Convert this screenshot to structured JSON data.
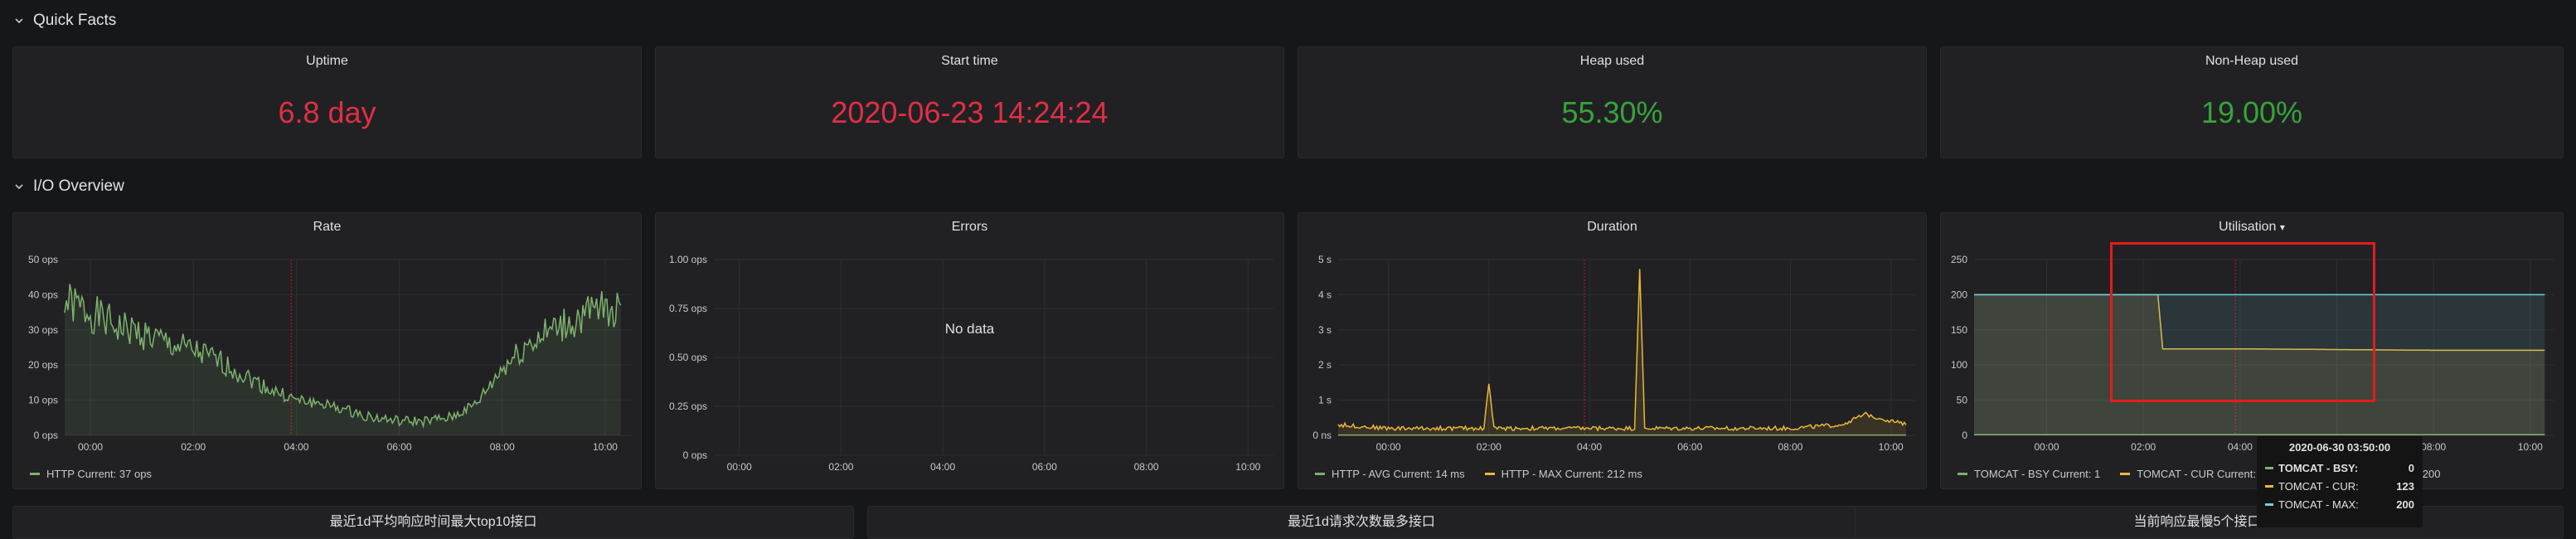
{
  "rows": {
    "quick_facts": "Quick Facts",
    "io_overview": "I/O Overview"
  },
  "stats": [
    {
      "title": "Uptime",
      "value": "6.8 day",
      "color": "#e02f44"
    },
    {
      "title": "Start time",
      "value": "2020-06-23 14:24:24",
      "color": "#e02f44"
    },
    {
      "title": "Heap used",
      "value": "55.30%",
      "color": "#37a43a"
    },
    {
      "title": "Non-Heap used",
      "value": "19.00%",
      "color": "#37a43a"
    }
  ],
  "colors": {
    "green_series": "#7eb26d",
    "yellow_series": "#eab839",
    "cyan_series": "#6ed0e0",
    "marker": "#c4162a"
  },
  "panels": {
    "rate": {
      "title": "Rate",
      "legend": [
        {
          "label": "HTTP  Current: 37 ops"
        }
      ]
    },
    "errors": {
      "title": "Errors",
      "nodata": "No data"
    },
    "duration": {
      "title": "Duration",
      "legend": [
        {
          "label": "HTTP - AVG  Current: 14 ms"
        },
        {
          "label": "HTTP - MAX  Current: 212 ms"
        }
      ]
    },
    "utilisation": {
      "title": "Utilisation",
      "caret": "▾",
      "legend": [
        {
          "label": "TOMCAT - BSY  Current: 1"
        },
        {
          "label": "TOMCAT - CUR  Current:"
        },
        {
          "label": "t: 200"
        }
      ]
    }
  },
  "tooltip": {
    "time": "2020-06-30 03:50:00",
    "rows": [
      {
        "label": "TOMCAT - BSY:",
        "value": "0",
        "color": "#7eb26d"
      },
      {
        "label": "TOMCAT - CUR:",
        "value": "123",
        "color": "#eab839"
      },
      {
        "label": "TOMCAT - MAX:",
        "value": "200",
        "color": "#6ed0e0"
      }
    ]
  },
  "bottom_panels": [
    {
      "title": "最近1d平均响应时间最大top10接口"
    },
    {
      "title": "最近1d请求次数最多接口"
    },
    {
      "title": "当前响应最慢5个接口"
    }
  ],
  "chart_data": [
    {
      "type": "line",
      "title": "Rate",
      "x_ticks": [
        "00:00",
        "02:00",
        "04:00",
        "06:00",
        "08:00",
        "10:00"
      ],
      "y_ticks": [
        "0 ops",
        "10 ops",
        "20 ops",
        "30 ops",
        "40 ops",
        "50 ops"
      ],
      "ylim": [
        0,
        50
      ],
      "xlim": [
        -0.5,
        10.5
      ],
      "series": [
        {
          "name": "HTTP",
          "x": [
            -0.5,
            0,
            0.5,
            1,
            1.5,
            2,
            2.5,
            3,
            3.5,
            4,
            4.5,
            5,
            5.5,
            6,
            6.5,
            7,
            7.5,
            8,
            8.5,
            9,
            9.5,
            10,
            10.3
          ],
          "values": [
            38,
            35,
            31,
            29,
            26,
            24,
            21,
            17,
            13,
            10,
            9,
            7,
            5,
            4,
            4,
            5,
            9,
            19,
            26,
            30,
            33,
            36,
            37
          ]
        }
      ]
    },
    {
      "type": "line",
      "title": "Errors",
      "x_ticks": [
        "00:00",
        "02:00",
        "04:00",
        "06:00",
        "08:00",
        "10:00"
      ],
      "y_ticks": [
        "0 ops",
        "0.25 ops",
        "0.50 ops",
        "0.75 ops",
        "1.00 ops"
      ],
      "ylim": [
        0,
        1
      ],
      "xlim": [
        -0.5,
        10.5
      ],
      "series": []
    },
    {
      "type": "line",
      "title": "Duration",
      "x_ticks": [
        "00:00",
        "02:00",
        "04:00",
        "06:00",
        "08:00",
        "10:00"
      ],
      "y_ticks": [
        "0 ns",
        "1 s",
        "2 s",
        "3 s",
        "4 s",
        "5 s"
      ],
      "ylim": [
        0,
        5
      ],
      "xlim": [
        -1,
        10.5
      ],
      "series": [
        {
          "name": "HTTP - AVG",
          "x": [
            -1,
            10.3
          ],
          "values": [
            0.01,
            0.01
          ]
        },
        {
          "name": "HTTP - MAX",
          "x": [
            -1,
            0,
            1,
            1.9,
            2,
            2.1,
            3,
            4,
            4.9,
            5,
            5.1,
            6,
            7,
            8,
            9,
            9.5,
            10.3
          ],
          "values": [
            0.3,
            0.2,
            0.2,
            0.2,
            1.5,
            0.2,
            0.2,
            0.2,
            0.2,
            4.7,
            0.2,
            0.2,
            0.2,
            0.2,
            0.3,
            0.6,
            0.3
          ]
        }
      ]
    },
    {
      "type": "line",
      "title": "Utilisation",
      "x_ticks": [
        "00:00",
        "02:00",
        "04:00",
        "06:00",
        "08:00",
        "10:00"
      ],
      "y_ticks": [
        "0",
        "50",
        "100",
        "150",
        "200",
        "250"
      ],
      "ylim": [
        0,
        250
      ],
      "xlim": [
        -1.5,
        10.5
      ],
      "series": [
        {
          "name": "TOMCAT - BSY",
          "x": [
            -1.5,
            10.3
          ],
          "values": [
            1,
            1
          ]
        },
        {
          "name": "TOMCAT - CUR",
          "x": [
            -1.5,
            2.3,
            2.4,
            4,
            6,
            8,
            10.3
          ],
          "values": [
            200,
            200,
            123,
            123,
            122,
            121,
            121
          ]
        },
        {
          "name": "TOMCAT - MAX",
          "x": [
            -1.5,
            10.3
          ],
          "values": [
            200,
            200
          ]
        }
      ]
    }
  ]
}
